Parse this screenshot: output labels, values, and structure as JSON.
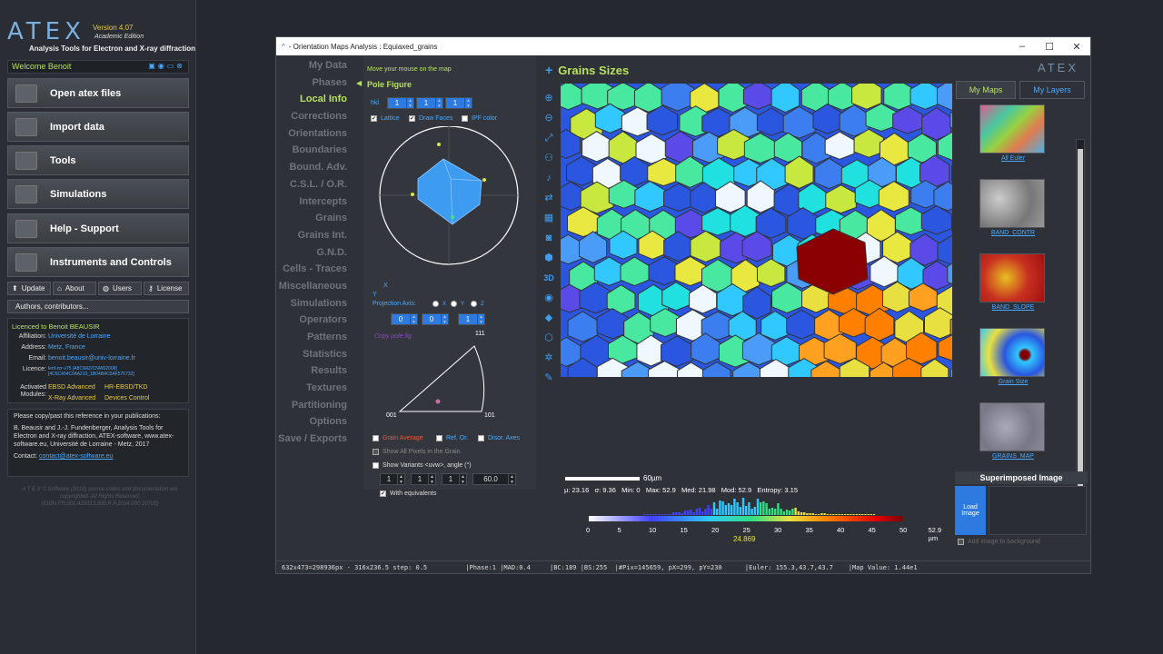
{
  "app": {
    "logo": "ATEX",
    "version": "Version 4.07",
    "edition": "Academic Edition",
    "subtitle": "Analysis Tools for Electron and X-ray diffraction",
    "welcome": "Welcome Benoit",
    "menu": [
      "Open atex files",
      "Import data",
      "Tools",
      "Simulations",
      "Help - Support",
      "Instruments and Controls"
    ],
    "small_buttons": [
      "Update",
      "About",
      "Users",
      "License"
    ],
    "authors": "Authors, contributors...",
    "licence": {
      "title": "Licenced to Benoit BEAUSIR",
      "affiliation_label": "Affiliation:",
      "affiliation": "Université de Lorraine",
      "address_label": "Address:",
      "address": "Metz, France",
      "email_label": "Email:",
      "email": "benoit.beausir@univ-lorraine.fr",
      "licence_label": "Licence:",
      "licence_key": "lenf-nrr-v75 [A8CWIZ/CNW02008] [4C6C454C04A210_1B04B4C0AF575732]",
      "modules_label": "Activated Modules:",
      "modules": [
        "EBSD Advanced",
        "HR-EBSD/TKD",
        "X-Ray Advanced",
        "Devices Control"
      ]
    },
    "ref": {
      "intro": "Please copy/past this reference in your publications:",
      "text": "B. Beausir and J.-J. Fundenberger, Analysis Tools for Electron and X-ray diffraction, ATEX-software, www.atex-software.eu, Université de Lorraine - Metz, 2017",
      "contact_label": "Contact:",
      "contact": "contact@atex-software.eu"
    },
    "copyright": "A T E X © Software (2018) source codes and documentation are copyrighted. All Rights Reserved. (IDDN.FR.001.420013.000.R.P.2014.000.20700)"
  },
  "window": {
    "title": "- Orientation Maps Analysis : Equiaxed_grains",
    "nav": [
      "My Data",
      "Phases",
      "Local Info",
      "Corrections",
      "Orientations",
      "Boundaries",
      "Bound. Adv.",
      "C.S.L. / O.R.",
      "Intercepts",
      "Grains",
      "Grains Int.",
      "G.N.D.",
      "Cells - Traces",
      "Miscellaneous",
      "Simulations",
      "Operators",
      "Patterns",
      "Statistics",
      "Results",
      "Textures",
      "Partitioning",
      "Options",
      "Save / Exports"
    ],
    "active_nav": "Local Info"
  },
  "local": {
    "hint": "Move your mouse on the map",
    "pole_title": "Pole Figure",
    "hkl_label": "hkl",
    "hkl": [
      "1",
      "1",
      "1"
    ],
    "checks1": [
      "Lattice",
      "Draw Faces",
      "IPF color"
    ],
    "axis_y": "Y",
    "axis_x": "X",
    "proj_label": "Projection Axis:",
    "proj_opts": [
      "X",
      "Y",
      "Z"
    ],
    "proj_vals": [
      "0",
      "0",
      "1"
    ],
    "copy_label": "Copy pole fig",
    "ipf_labels": [
      "111",
      "001",
      "101"
    ],
    "checks2": [
      "Grain Average",
      "Ref. Or.",
      "Disor. Axes"
    ],
    "all_pixels": "Show All Pixels in the Grain",
    "variants": "Show Variants <uvw>, angle (°)",
    "var_vals": [
      "1",
      "1",
      "1",
      "60.0"
    ],
    "with_eq": "With equivalents"
  },
  "map": {
    "title": "Grains Sizes",
    "atex": "ATEX",
    "scalebar": "60µm",
    "stats": "µ: 23.16   σ: 9.36   Min: 0   Max: 52.9   Med: 21.98   Mod: 52.9   Entropy: 3.15",
    "ticks": [
      "0",
      "5",
      "10",
      "15",
      "20",
      "25",
      "30",
      "35",
      "40",
      "45",
      "50",
      "52.9 µm"
    ],
    "marker": "24.869"
  },
  "right": {
    "tab1": "My Maps",
    "tab2": "My Layers",
    "maps": [
      "All Euler",
      "BAND_CONTR",
      "BAND_SLOPE",
      "Grain Size",
      "GRAINS_MAP"
    ],
    "super_title": "Superimposed Image",
    "load": "Load Image",
    "add_bg": "Add image to background"
  },
  "status": "632x473=298936px - 316x236.5 step: 0.5          |Phase:1 |MAD:0.4     |BC:189 |BS:255  |#Pix=145659, pX=299, pY=230      |Euler: 155.3,43.7,43.7    |Map Value: 1.44e1"
}
